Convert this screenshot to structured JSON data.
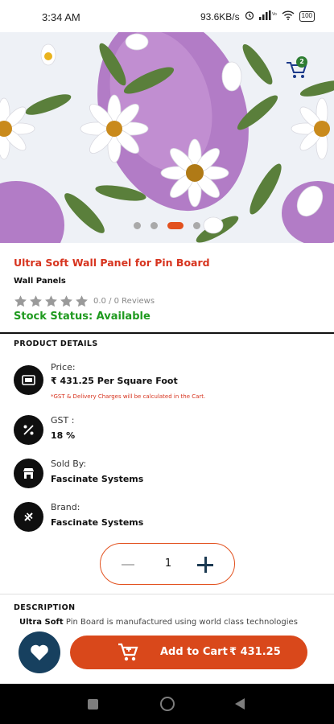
{
  "status_bar": {
    "time": "3:34 AM",
    "speed": "93.6KB/s",
    "battery": "100"
  },
  "carousel": {
    "slide_count": 4,
    "active_index": 2,
    "cart_badge_count": "2"
  },
  "product": {
    "title": "Ultra Soft Wall Panel for Pin Board",
    "category": "Wall Panels",
    "rating_value": 0,
    "rating_text": "0.0 / 0 Reviews",
    "stock_status": "Stock Status: Available"
  },
  "details": {
    "heading": "PRODUCT DETAILS",
    "price_label": "Price:",
    "price_value": "₹ 431.25 Per Square Foot",
    "price_note": "*GST & Delivery Charges will be calculated in the Cart.",
    "gst_label": "GST :",
    "gst_value": "18 %",
    "sold_by_label": "Sold By:",
    "sold_by_value": "Fascinate Systems",
    "brand_label": "Brand:",
    "brand_value": "Fascinate Systems"
  },
  "quantity": {
    "value": "1"
  },
  "description": {
    "heading": "DESCRIPTION",
    "lead": "Ultra Soft",
    "text": " Pin Board is manufactured using world class technologies"
  },
  "bottom_bar": {
    "add_to_cart_label": "Add to Cart",
    "add_to_cart_amount": "₹ 431.25"
  },
  "colors": {
    "accent": "#d9481b",
    "title_red": "#d7341f",
    "stock_green": "#1f9a1f",
    "navy": "#17405f"
  }
}
